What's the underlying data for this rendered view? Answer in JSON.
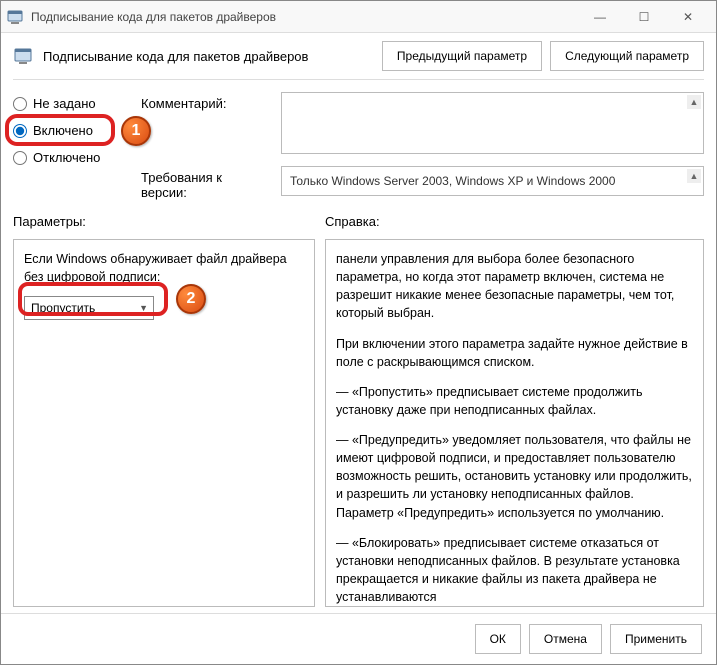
{
  "window": {
    "title": "Подписывание кода для пакетов драйверов"
  },
  "toolbar": {
    "policy_name": "Подписывание кода для пакетов драйверов",
    "prev_label": "Предыдущий параметр",
    "next_label": "Следующий параметр"
  },
  "state_radios": {
    "not_configured": "Не задано",
    "enabled": "Включено",
    "disabled": "Отключено"
  },
  "fields": {
    "comment_label": "Комментарий:",
    "version_label": "Требования к версии:",
    "version_value": "Только Windows Server 2003, Windows XP и Windows 2000"
  },
  "sections": {
    "options_label": "Параметры:",
    "help_label": "Справка:"
  },
  "options": {
    "unsigned_prompt": "Если Windows обнаруживает файл драйвера без цифровой подписи:",
    "dropdown_value": "Пропустить"
  },
  "help": {
    "p1": "панели управления для выбора более безопасного параметра, но когда этот параметр включен, система не разрешит никакие менее безопасные параметры, чем тот, который выбран.",
    "p2": "При включении этого параметра задайте нужное действие в поле с раскрывающимся списком.",
    "p3": "—   «Пропустить» предписывает системе продолжить установку даже при неподписанных файлах.",
    "p4": "—   «Предупредить» уведомляет пользователя, что файлы не имеют цифровой подписи, и предоставляет пользователю возможность решить, остановить установку или продолжить, и разрешить ли установку неподписанных файлов. Параметр «Предупредить» используется по умолчанию.",
    "p5": "—   «Блокировать» предписывает системе отказаться от установки неподписанных файлов. В результате установка прекращается и никакие файлы из пакета драйвера не устанавливаются"
  },
  "footer": {
    "ok": "ОК",
    "cancel": "Отмена",
    "apply": "Применить"
  },
  "markers": {
    "m1": "1",
    "m2": "2"
  }
}
